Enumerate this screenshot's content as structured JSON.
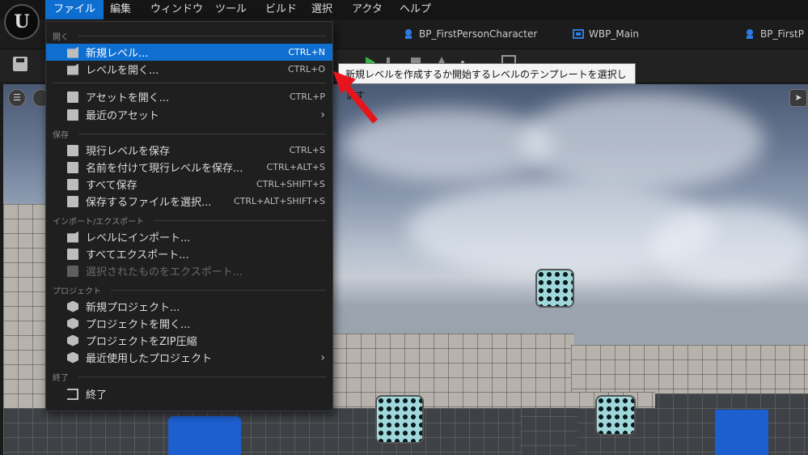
{
  "menubar": {
    "items": [
      "ファイル",
      "編集",
      "ウィンドウ",
      "ツール",
      "ビルド",
      "選択",
      "アクタ",
      "ヘルプ"
    ],
    "active_index": 0
  },
  "tabs": [
    {
      "label": "BP_FirstPersonCharacter",
      "icon": "blueprint-character-icon"
    },
    {
      "label": "WBP_Main",
      "icon": "widget-blueprint-icon"
    },
    {
      "label": "BP_FirstP",
      "icon": "blueprint-character-icon"
    }
  ],
  "file_menu": {
    "sections": {
      "open": "開く",
      "save": "保存",
      "import_export": "インポート/エクスポート",
      "project": "プロジェクト",
      "exit": "終了"
    },
    "items": [
      {
        "label": "新規レベル...",
        "shortcut": "CTRL+N",
        "icon": "new-level-icon",
        "highlighted": true
      },
      {
        "label": "レベルを開く...",
        "shortcut": "CTRL+O",
        "icon": "open-level-icon"
      },
      {
        "label": "アセットを開く...",
        "shortcut": "CTRL+P",
        "icon": "open-asset-icon"
      },
      {
        "label": "最近のアセット",
        "shortcut": "",
        "icon": "recent-assets-icon",
        "submenu": true
      },
      {
        "label": "現行レベルを保存",
        "shortcut": "CTRL+S",
        "icon": "save-icon"
      },
      {
        "label": "名前を付けて現行レベルを保存...",
        "shortcut": "CTRL+ALT+S",
        "icon": "save-as-icon"
      },
      {
        "label": "すべて保存",
        "shortcut": "CTRL+SHIFT+S",
        "icon": "save-all-icon"
      },
      {
        "label": "保存するファイルを選択...",
        "shortcut": "CTRL+ALT+SHIFT+S",
        "icon": "choose-files-icon"
      },
      {
        "label": "レベルにインポート...",
        "shortcut": "",
        "icon": "import-icon"
      },
      {
        "label": "すべてエクスポート...",
        "shortcut": "",
        "icon": "export-all-icon"
      },
      {
        "label": "選択されたものをエクスポート...",
        "shortcut": "",
        "icon": "export-selected-icon",
        "disabled": true
      },
      {
        "label": "新規プロジェクト...",
        "shortcut": "",
        "icon": "new-project-icon"
      },
      {
        "label": "プロジェクトを開く...",
        "shortcut": "",
        "icon": "open-project-icon"
      },
      {
        "label": "プロジェクトをZIP圧縮",
        "shortcut": "",
        "icon": "zip-project-icon"
      },
      {
        "label": "最近使用したプロジェクト",
        "shortcut": "",
        "icon": "recent-projects-icon",
        "submenu": true
      },
      {
        "label": "終了",
        "shortcut": "",
        "icon": "exit-icon"
      }
    ]
  },
  "tooltip": {
    "text": "新規レベルを作成するか開始するレベルのテンプレートを選択します"
  },
  "colors": {
    "accent": "#0e6fd1",
    "arrow": "#e8141b"
  }
}
